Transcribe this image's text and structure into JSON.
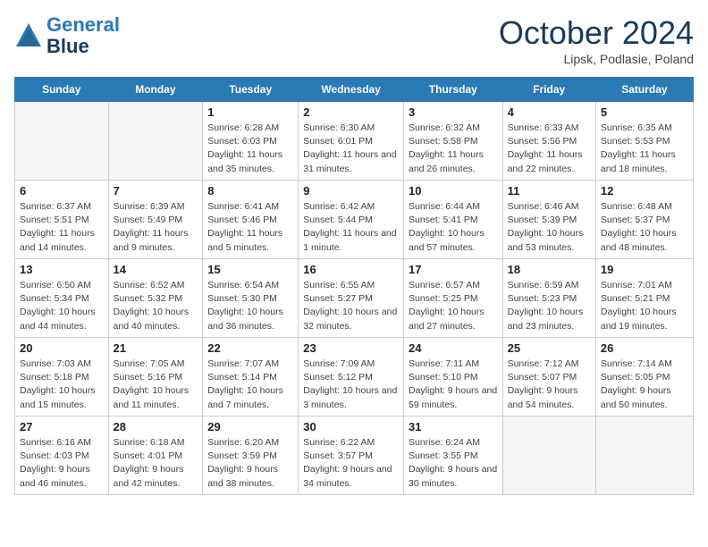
{
  "header": {
    "logo_line1": "General",
    "logo_line2": "Blue",
    "month": "October 2024",
    "location": "Lipsk, Podlasie, Poland"
  },
  "weekdays": [
    "Sunday",
    "Monday",
    "Tuesday",
    "Wednesday",
    "Thursday",
    "Friday",
    "Saturday"
  ],
  "weeks": [
    [
      {
        "day": "",
        "info": ""
      },
      {
        "day": "",
        "info": ""
      },
      {
        "day": "1",
        "info": "Sunrise: 6:28 AM\nSunset: 6:03 PM\nDaylight: 11 hours and 35 minutes."
      },
      {
        "day": "2",
        "info": "Sunrise: 6:30 AM\nSunset: 6:01 PM\nDaylight: 11 hours and 31 minutes."
      },
      {
        "day": "3",
        "info": "Sunrise: 6:32 AM\nSunset: 5:58 PM\nDaylight: 11 hours and 26 minutes."
      },
      {
        "day": "4",
        "info": "Sunrise: 6:33 AM\nSunset: 5:56 PM\nDaylight: 11 hours and 22 minutes."
      },
      {
        "day": "5",
        "info": "Sunrise: 6:35 AM\nSunset: 5:53 PM\nDaylight: 11 hours and 18 minutes."
      }
    ],
    [
      {
        "day": "6",
        "info": "Sunrise: 6:37 AM\nSunset: 5:51 PM\nDaylight: 11 hours and 14 minutes."
      },
      {
        "day": "7",
        "info": "Sunrise: 6:39 AM\nSunset: 5:49 PM\nDaylight: 11 hours and 9 minutes."
      },
      {
        "day": "8",
        "info": "Sunrise: 6:41 AM\nSunset: 5:46 PM\nDaylight: 11 hours and 5 minutes."
      },
      {
        "day": "9",
        "info": "Sunrise: 6:42 AM\nSunset: 5:44 PM\nDaylight: 11 hours and 1 minute."
      },
      {
        "day": "10",
        "info": "Sunrise: 6:44 AM\nSunset: 5:41 PM\nDaylight: 10 hours and 57 minutes."
      },
      {
        "day": "11",
        "info": "Sunrise: 6:46 AM\nSunset: 5:39 PM\nDaylight: 10 hours and 53 minutes."
      },
      {
        "day": "12",
        "info": "Sunrise: 6:48 AM\nSunset: 5:37 PM\nDaylight: 10 hours and 48 minutes."
      }
    ],
    [
      {
        "day": "13",
        "info": "Sunrise: 6:50 AM\nSunset: 5:34 PM\nDaylight: 10 hours and 44 minutes."
      },
      {
        "day": "14",
        "info": "Sunrise: 6:52 AM\nSunset: 5:32 PM\nDaylight: 10 hours and 40 minutes."
      },
      {
        "day": "15",
        "info": "Sunrise: 6:54 AM\nSunset: 5:30 PM\nDaylight: 10 hours and 36 minutes."
      },
      {
        "day": "16",
        "info": "Sunrise: 6:55 AM\nSunset: 5:27 PM\nDaylight: 10 hours and 32 minutes."
      },
      {
        "day": "17",
        "info": "Sunrise: 6:57 AM\nSunset: 5:25 PM\nDaylight: 10 hours and 27 minutes."
      },
      {
        "day": "18",
        "info": "Sunrise: 6:59 AM\nSunset: 5:23 PM\nDaylight: 10 hours and 23 minutes."
      },
      {
        "day": "19",
        "info": "Sunrise: 7:01 AM\nSunset: 5:21 PM\nDaylight: 10 hours and 19 minutes."
      }
    ],
    [
      {
        "day": "20",
        "info": "Sunrise: 7:03 AM\nSunset: 5:18 PM\nDaylight: 10 hours and 15 minutes."
      },
      {
        "day": "21",
        "info": "Sunrise: 7:05 AM\nSunset: 5:16 PM\nDaylight: 10 hours and 11 minutes."
      },
      {
        "day": "22",
        "info": "Sunrise: 7:07 AM\nSunset: 5:14 PM\nDaylight: 10 hours and 7 minutes."
      },
      {
        "day": "23",
        "info": "Sunrise: 7:09 AM\nSunset: 5:12 PM\nDaylight: 10 hours and 3 minutes."
      },
      {
        "day": "24",
        "info": "Sunrise: 7:11 AM\nSunset: 5:10 PM\nDaylight: 9 hours and 59 minutes."
      },
      {
        "day": "25",
        "info": "Sunrise: 7:12 AM\nSunset: 5:07 PM\nDaylight: 9 hours and 54 minutes."
      },
      {
        "day": "26",
        "info": "Sunrise: 7:14 AM\nSunset: 5:05 PM\nDaylight: 9 hours and 50 minutes."
      }
    ],
    [
      {
        "day": "27",
        "info": "Sunrise: 6:16 AM\nSunset: 4:03 PM\nDaylight: 9 hours and 46 minutes."
      },
      {
        "day": "28",
        "info": "Sunrise: 6:18 AM\nSunset: 4:01 PM\nDaylight: 9 hours and 42 minutes."
      },
      {
        "day": "29",
        "info": "Sunrise: 6:20 AM\nSunset: 3:59 PM\nDaylight: 9 hours and 38 minutes."
      },
      {
        "day": "30",
        "info": "Sunrise: 6:22 AM\nSunset: 3:57 PM\nDaylight: 9 hours and 34 minutes."
      },
      {
        "day": "31",
        "info": "Sunrise: 6:24 AM\nSunset: 3:55 PM\nDaylight: 9 hours and 30 minutes."
      },
      {
        "day": "",
        "info": ""
      },
      {
        "day": "",
        "info": ""
      }
    ]
  ]
}
